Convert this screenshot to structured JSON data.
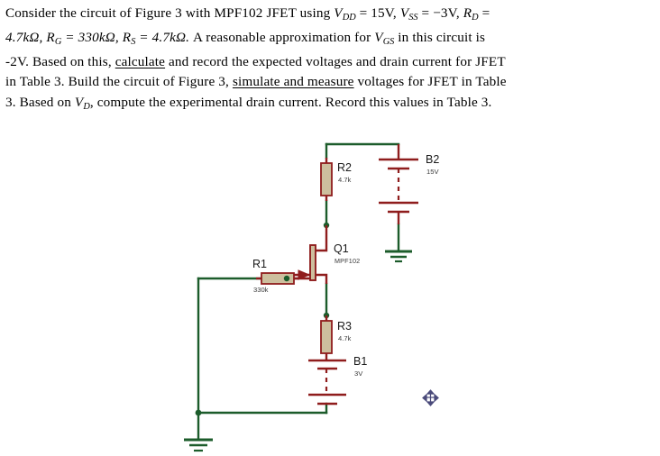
{
  "document": {
    "type": "circuit-analysis-problem",
    "problem_text": {
      "line1_parts": {
        "a": "Consider the circuit of Figure 3 with MPF102 JFET using ",
        "v_dd": "V",
        "v_dd_sub": "DD",
        "eq1": " = 15V,  ",
        "v_ss": "V",
        "v_ss_sub": "SS",
        "eq2": " = −3V,  ",
        "r_d": "R",
        "r_d_sub": "D",
        "eq3": " ="
      },
      "line2_parts": {
        "a": "4.7kΩ, ",
        "r_g": "R",
        "r_g_sub": "G",
        "eq1": " = 330kΩ, ",
        "r_s": "R",
        "r_s_sub": "S",
        "eq2": " = 4.7kΩ.",
        "b": "  A reasonable approximation for ",
        "v_gs": "V",
        "v_gs_sub": "GS",
        "c": "  in this circuit is"
      },
      "line3_parts": {
        "a": "-2V. Based on this, ",
        "underlined": "calculate",
        "b": " and record the expected voltages and drain current for JFET"
      },
      "line4_parts": {
        "a": "in Table 3.  Build the circuit of Figure 3, ",
        "underlined": "simulate and measure",
        "b": " voltages for JFET in Table"
      },
      "line5_parts": {
        "a": "3. Based on  ",
        "v_d": "V",
        "v_d_sub": "D",
        "b": ",  compute the experimental drain current.  Record this values in Table 3."
      }
    }
  },
  "schematic": {
    "title": "Figure 3 JFET bias circuit",
    "colors": {
      "wire": "#1c5c2b",
      "component": "#8f1d1d",
      "resistor_body": "#cdbf9e",
      "junction": "#1c5c2b",
      "cursor": "#4a4a7a"
    },
    "components": [
      {
        "id": "R2",
        "ref": "R2",
        "value": "4.7k",
        "type": "resistor",
        "orientation": "vertical"
      },
      {
        "id": "B2",
        "ref": "B2",
        "value": "15V",
        "type": "battery",
        "orientation": "vertical"
      },
      {
        "id": "Q1",
        "ref": "Q1",
        "value": "MPF102",
        "type": "jfet-n-channel",
        "orientation": "vertical"
      },
      {
        "id": "R1",
        "ref": "R1",
        "value": "330k",
        "type": "resistor",
        "orientation": "horizontal"
      },
      {
        "id": "R3",
        "ref": "R3",
        "value": "4.7k",
        "type": "resistor",
        "orientation": "vertical"
      },
      {
        "id": "B1",
        "ref": "B1",
        "value": "3V",
        "type": "battery",
        "orientation": "vertical"
      }
    ],
    "grounds": [
      {
        "id": "gnd-b2",
        "label": ""
      },
      {
        "id": "gnd-main",
        "label": ""
      }
    ],
    "cursor": {
      "name": "move-cursor",
      "shape": "four-way-arrow"
    }
  }
}
